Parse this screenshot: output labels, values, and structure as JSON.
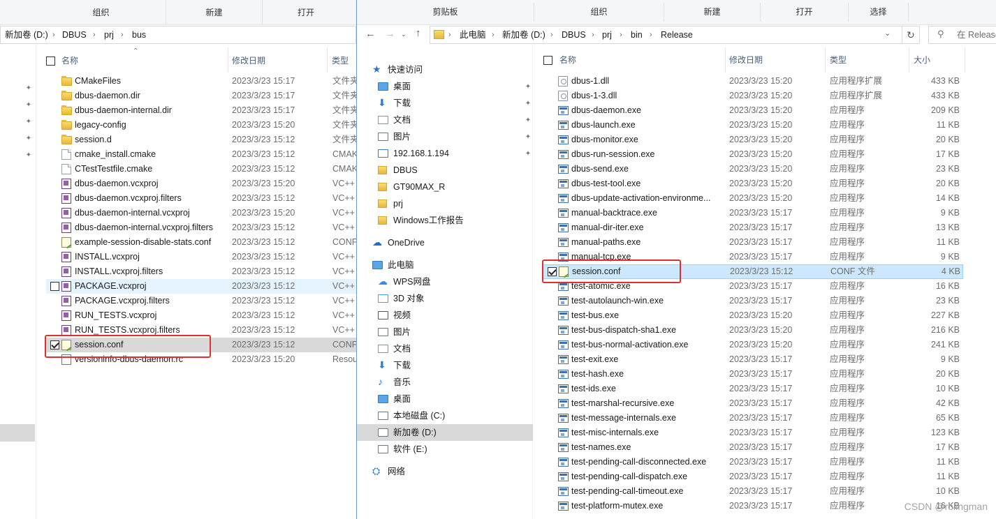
{
  "left": {
    "ribbon": [
      "组织",
      "新建",
      "打开"
    ],
    "address": [
      "新加卷 (D:)",
      "DBUS",
      "prj",
      "bus"
    ],
    "columns": {
      "name": "名称",
      "modified": "修改日期",
      "type": "类型"
    },
    "files": [
      {
        "name": "CMakeFiles",
        "date": "2023/3/23 15:17",
        "type": "文件夹",
        "icon": "folder-icon"
      },
      {
        "name": "dbus-daemon.dir",
        "date": "2023/3/23 15:17",
        "type": "文件夹",
        "icon": "folder-icon"
      },
      {
        "name": "dbus-daemon-internal.dir",
        "date": "2023/3/23 15:17",
        "type": "文件夹",
        "icon": "folder-icon"
      },
      {
        "name": "legacy-config",
        "date": "2023/3/23 15:20",
        "type": "文件夹",
        "icon": "folder-icon"
      },
      {
        "name": "session.d",
        "date": "2023/3/23 15:12",
        "type": "文件夹",
        "icon": "folder-icon"
      },
      {
        "name": "cmake_install.cmake",
        "date": "2023/3/23 15:12",
        "type": "CMAKE",
        "icon": "text-file-icon"
      },
      {
        "name": "CTestTestfile.cmake",
        "date": "2023/3/23 15:12",
        "type": "CMAKE",
        "icon": "text-file-icon"
      },
      {
        "name": "dbus-daemon.vcxproj",
        "date": "2023/3/23 15:20",
        "type": "VC++",
        "icon": "vcxproj-icon"
      },
      {
        "name": "dbus-daemon.vcxproj.filters",
        "date": "2023/3/23 15:12",
        "type": "VC++",
        "icon": "vcxproj-icon"
      },
      {
        "name": "dbus-daemon-internal.vcxproj",
        "date": "2023/3/23 15:20",
        "type": "VC++",
        "icon": "vcxproj-icon"
      },
      {
        "name": "dbus-daemon-internal.vcxproj.filters",
        "date": "2023/3/23 15:12",
        "type": "VC++",
        "icon": "vcxproj-icon"
      },
      {
        "name": "example-session-disable-stats.conf",
        "date": "2023/3/23 15:12",
        "type": "CONF",
        "icon": "conf-file-icon"
      },
      {
        "name": "INSTALL.vcxproj",
        "date": "2023/3/23 15:12",
        "type": "VC++",
        "icon": "vcxproj-icon"
      },
      {
        "name": "INSTALL.vcxproj.filters",
        "date": "2023/3/23 15:12",
        "type": "VC++",
        "icon": "vcxproj-icon"
      },
      {
        "name": "PACKAGE.vcxproj",
        "date": "2023/3/23 15:12",
        "type": "VC++",
        "icon": "vcxproj-icon",
        "hover": true
      },
      {
        "name": "PACKAGE.vcxproj.filters",
        "date": "2023/3/23 15:12",
        "type": "VC++",
        "icon": "vcxproj-icon"
      },
      {
        "name": "RUN_TESTS.vcxproj",
        "date": "2023/3/23 15:12",
        "type": "VC++",
        "icon": "vcxproj-icon"
      },
      {
        "name": "RUN_TESTS.vcxproj.filters",
        "date": "2023/3/23 15:12",
        "type": "VC++",
        "icon": "vcxproj-icon"
      },
      {
        "name": "session.conf",
        "date": "2023/3/23 15:12",
        "type": "CONF",
        "icon": "conf-file-icon",
        "selected": true
      },
      {
        "name": "versioninfo-dbus-daemon.rc",
        "date": "2023/3/23 15:20",
        "type": "Resou",
        "icon": "rc-file-icon"
      }
    ]
  },
  "right": {
    "ribbon": [
      "剪贴板",
      "组织",
      "新建",
      "打开",
      "选择"
    ],
    "address": [
      "此电脑",
      "新加卷 (D:)",
      "DBUS",
      "prj",
      "bin",
      "Release"
    ],
    "search_placeholder": "在 Release",
    "columns": {
      "name": "名称",
      "modified": "修改日期",
      "type": "类型",
      "size": "大小"
    },
    "nav": [
      {
        "label": "快速访问",
        "icon": "star-icon",
        "pinned": false
      },
      {
        "label": "桌面",
        "icon": "desktop-icon",
        "pinned": true
      },
      {
        "label": "下载",
        "icon": "download-icon",
        "pinned": true
      },
      {
        "label": "文档",
        "icon": "document-icon",
        "pinned": true
      },
      {
        "label": "图片",
        "icon": "picture-icon",
        "pinned": true
      },
      {
        "label": "192.168.1.194",
        "icon": "network-drive-icon",
        "pinned": true
      },
      {
        "label": "DBUS",
        "icon": "folder-icon",
        "pinned": false
      },
      {
        "label": "GT90MAX_R",
        "icon": "folder-icon",
        "pinned": false
      },
      {
        "label": "prj",
        "icon": "folder-icon",
        "pinned": false
      },
      {
        "label": "Windows工作报告",
        "icon": "folder-check-icon",
        "pinned": false
      },
      {
        "label": "OneDrive",
        "icon": "cloud-icon",
        "pinned": false
      },
      {
        "label": "此电脑",
        "icon": "computer-icon",
        "pinned": false
      },
      {
        "label": "WPS网盘",
        "icon": "wps-cloud-icon",
        "pinned": false
      },
      {
        "label": "3D 对象",
        "icon": "cube-icon",
        "pinned": false
      },
      {
        "label": "视频",
        "icon": "video-icon",
        "pinned": false
      },
      {
        "label": "图片",
        "icon": "picture-icon",
        "pinned": false
      },
      {
        "label": "文档",
        "icon": "document-icon",
        "pinned": false
      },
      {
        "label": "下载",
        "icon": "download-icon",
        "pinned": false
      },
      {
        "label": "音乐",
        "icon": "music-icon",
        "pinned": false
      },
      {
        "label": "桌面",
        "icon": "desktop-icon",
        "pinned": false
      },
      {
        "label": "本地磁盘 (C:)",
        "icon": "drive-c-icon",
        "pinned": false
      },
      {
        "label": "新加卷 (D:)",
        "icon": "drive-icon",
        "pinned": false,
        "selected": true
      },
      {
        "label": "软件 (E:)",
        "icon": "drive-icon",
        "pinned": false
      },
      {
        "label": "网络",
        "icon": "network-icon",
        "pinned": false
      }
    ],
    "files": [
      {
        "name": "dbus-1.dll",
        "date": "2023/3/23 15:20",
        "type": "应用程序扩展",
        "size": "433 KB",
        "icon": "dll-icon"
      },
      {
        "name": "dbus-1-3.dll",
        "date": "2023/3/23 15:20",
        "type": "应用程序扩展",
        "size": "433 KB",
        "icon": "dll-icon"
      },
      {
        "name": "dbus-daemon.exe",
        "date": "2023/3/23 15:20",
        "type": "应用程序",
        "size": "209 KB",
        "icon": "exe-icon"
      },
      {
        "name": "dbus-launch.exe",
        "date": "2023/3/23 15:20",
        "type": "应用程序",
        "size": "11 KB",
        "icon": "exe-icon"
      },
      {
        "name": "dbus-monitor.exe",
        "date": "2023/3/23 15:20",
        "type": "应用程序",
        "size": "20 KB",
        "icon": "exe-icon"
      },
      {
        "name": "dbus-run-session.exe",
        "date": "2023/3/23 15:20",
        "type": "应用程序",
        "size": "17 KB",
        "icon": "exe-icon"
      },
      {
        "name": "dbus-send.exe",
        "date": "2023/3/23 15:20",
        "type": "应用程序",
        "size": "23 KB",
        "icon": "exe-icon"
      },
      {
        "name": "dbus-test-tool.exe",
        "date": "2023/3/23 15:20",
        "type": "应用程序",
        "size": "20 KB",
        "icon": "exe-icon"
      },
      {
        "name": "dbus-update-activation-environme...",
        "date": "2023/3/23 15:20",
        "type": "应用程序",
        "size": "14 KB",
        "icon": "exe-icon"
      },
      {
        "name": "manual-backtrace.exe",
        "date": "2023/3/23 15:17",
        "type": "应用程序",
        "size": "9 KB",
        "icon": "exe-icon"
      },
      {
        "name": "manual-dir-iter.exe",
        "date": "2023/3/23 15:17",
        "type": "应用程序",
        "size": "13 KB",
        "icon": "exe-icon"
      },
      {
        "name": "manual-paths.exe",
        "date": "2023/3/23 15:17",
        "type": "应用程序",
        "size": "11 KB",
        "icon": "exe-icon"
      },
      {
        "name": "manual-tcp.exe",
        "date": "2023/3/23 15:17",
        "type": "应用程序",
        "size": "9 KB",
        "icon": "exe-icon"
      },
      {
        "name": "session.conf",
        "date": "2023/3/23 15:12",
        "type": "CONF 文件",
        "size": "4 KB",
        "icon": "conf-file-icon",
        "selected": true
      },
      {
        "name": "test-atomic.exe",
        "date": "2023/3/23 15:17",
        "type": "应用程序",
        "size": "16 KB",
        "icon": "exe-icon"
      },
      {
        "name": "test-autolaunch-win.exe",
        "date": "2023/3/23 15:17",
        "type": "应用程序",
        "size": "23 KB",
        "icon": "exe-icon"
      },
      {
        "name": "test-bus.exe",
        "date": "2023/3/23 15:20",
        "type": "应用程序",
        "size": "227 KB",
        "icon": "exe-icon"
      },
      {
        "name": "test-bus-dispatch-sha1.exe",
        "date": "2023/3/23 15:20",
        "type": "应用程序",
        "size": "216 KB",
        "icon": "exe-icon"
      },
      {
        "name": "test-bus-normal-activation.exe",
        "date": "2023/3/23 15:20",
        "type": "应用程序",
        "size": "241 KB",
        "icon": "exe-icon"
      },
      {
        "name": "test-exit.exe",
        "date": "2023/3/23 15:17",
        "type": "应用程序",
        "size": "9 KB",
        "icon": "exe-icon"
      },
      {
        "name": "test-hash.exe",
        "date": "2023/3/23 15:17",
        "type": "应用程序",
        "size": "20 KB",
        "icon": "exe-icon"
      },
      {
        "name": "test-ids.exe",
        "date": "2023/3/23 15:17",
        "type": "应用程序",
        "size": "10 KB",
        "icon": "exe-icon"
      },
      {
        "name": "test-marshal-recursive.exe",
        "date": "2023/3/23 15:17",
        "type": "应用程序",
        "size": "42 KB",
        "icon": "exe-icon"
      },
      {
        "name": "test-message-internals.exe",
        "date": "2023/3/23 15:17",
        "type": "应用程序",
        "size": "65 KB",
        "icon": "exe-icon"
      },
      {
        "name": "test-misc-internals.exe",
        "date": "2023/3/23 15:17",
        "type": "应用程序",
        "size": "123 KB",
        "icon": "exe-icon"
      },
      {
        "name": "test-names.exe",
        "date": "2023/3/23 15:17",
        "type": "应用程序",
        "size": "17 KB",
        "icon": "exe-icon"
      },
      {
        "name": "test-pending-call-disconnected.exe",
        "date": "2023/3/23 15:17",
        "type": "应用程序",
        "size": "11 KB",
        "icon": "exe-icon"
      },
      {
        "name": "test-pending-call-dispatch.exe",
        "date": "2023/3/23 15:17",
        "type": "应用程序",
        "size": "11 KB",
        "icon": "exe-icon"
      },
      {
        "name": "test-pending-call-timeout.exe",
        "date": "2023/3/23 15:17",
        "type": "应用程序",
        "size": "10 KB",
        "icon": "exe-icon"
      },
      {
        "name": "test-platform-mutex.exe",
        "date": "2023/3/23 15:17",
        "type": "应用程序",
        "size": "16 KB",
        "icon": "exe-icon"
      }
    ]
  },
  "watermark": "CSDN @rolingman",
  "colors": {
    "selection": "#cce8ff",
    "selection_border": "#99d1ff",
    "highlight_box": "#e0302c",
    "hover": "#e5f3ff",
    "grey_selection": "#d9d9d9"
  }
}
